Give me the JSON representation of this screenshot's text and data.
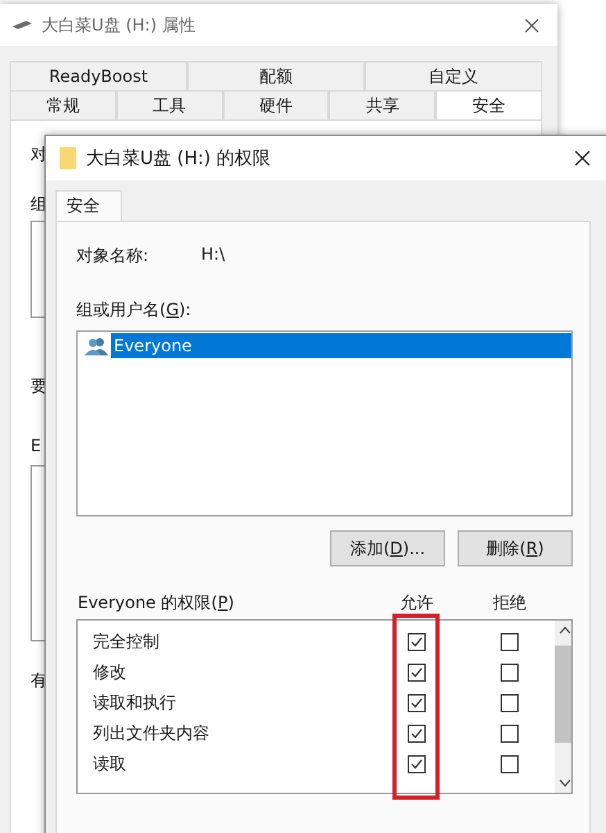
{
  "back_window": {
    "title": "大白菜U盘 (H:) 属性",
    "tab_rows": [
      [
        {
          "label": "ReadyBoost",
          "selected": false
        },
        {
          "label": "配额",
          "selected": false
        },
        {
          "label": "自定义",
          "selected": false
        }
      ],
      [
        {
          "label": "常规",
          "selected": false
        },
        {
          "label": "工具",
          "selected": false
        },
        {
          "label": "硬件",
          "selected": false
        },
        {
          "label": "共享",
          "selected": false
        },
        {
          "label": "安全",
          "selected": true
        }
      ]
    ],
    "partial_labels": [
      "对",
      "组",
      "要",
      "E",
      "有"
    ]
  },
  "dialog": {
    "title": "大白菜U盘 (H:) 的权限",
    "tabs": [
      {
        "label": "安全",
        "selected": true
      }
    ],
    "object_name_label": "对象名称:",
    "object_name": "H:\\",
    "groups_label": [
      "组或用户名(",
      "G",
      "):"
    ],
    "users": [
      {
        "name": "Everyone",
        "selected": true
      }
    ],
    "buttons": [
      [
        "添加(",
        "D",
        ")..."
      ],
      [
        "删除(",
        "R",
        ")"
      ]
    ],
    "permissions_label": [
      "Everyone 的权限(",
      "P",
      ")"
    ],
    "columns": [
      {
        "label": "允许",
        "highlighted": true
      },
      {
        "label": "拒绝",
        "highlighted": false
      }
    ],
    "permissions": [
      {
        "name": "完全控制",
        "allow": true,
        "deny": false
      },
      {
        "name": "修改",
        "allow": true,
        "deny": false
      },
      {
        "name": "读取和执行",
        "allow": true,
        "deny": false
      },
      {
        "name": "列出文件夹内容",
        "allow": true,
        "deny": false
      },
      {
        "name": "读取",
        "allow": true,
        "deny": false
      }
    ]
  }
}
